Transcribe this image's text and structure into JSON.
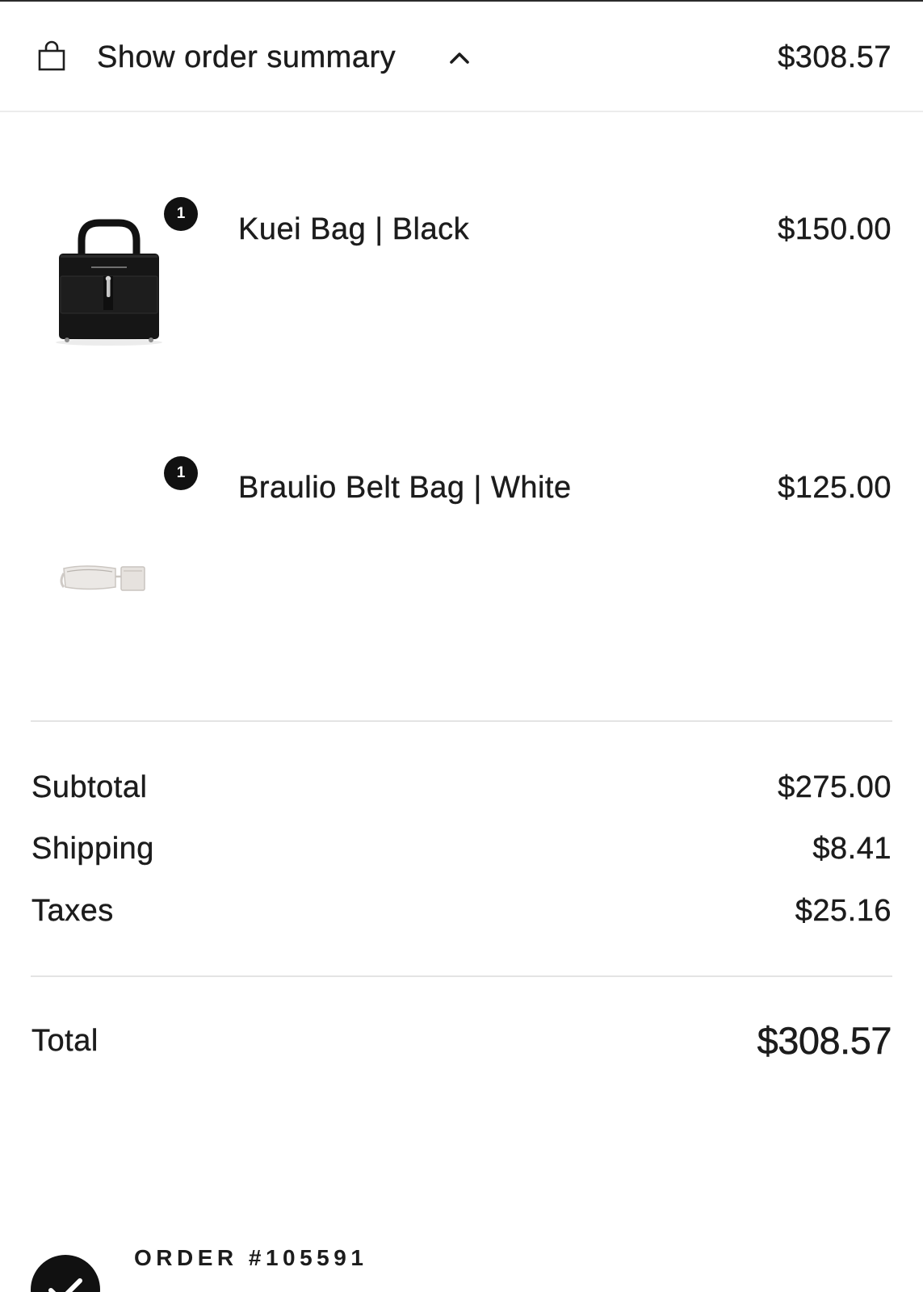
{
  "header": {
    "title": "Show order summary",
    "total": "$308.57",
    "icons": {
      "bag": "shopping-bag-icon",
      "chevron": "chevron-up-icon"
    }
  },
  "items": [
    {
      "quantity": "1",
      "name": "Kuei Bag | Black",
      "price": "$150.00"
    },
    {
      "quantity": "1",
      "name": "Braulio Belt Bag | White",
      "price": "$125.00"
    }
  ],
  "summary": {
    "subtotal_label": "Subtotal",
    "subtotal": "$275.00",
    "shipping_label": "Shipping",
    "shipping": "$8.41",
    "taxes_label": "Taxes",
    "taxes": "$25.16",
    "total_label": "Total",
    "total": "$308.57"
  },
  "order": {
    "number": "ORDER #105591",
    "status_icon": "check-circle-icon"
  },
  "colors": {
    "text": "#1c1c1c",
    "divider": "#e4e4e4",
    "badge": "#111111"
  }
}
